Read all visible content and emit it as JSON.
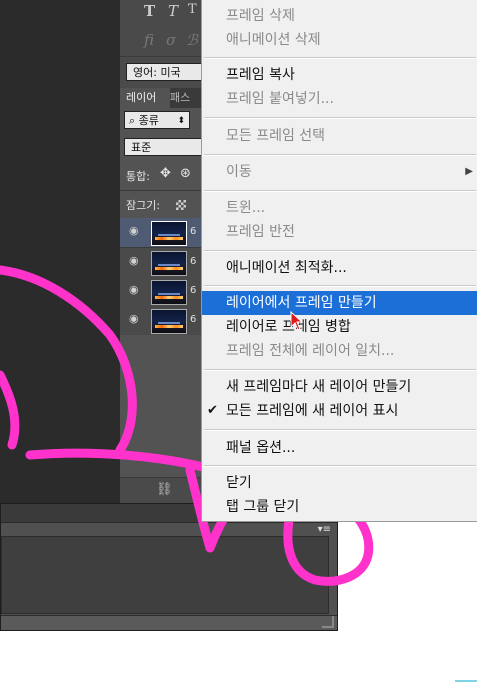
{
  "ps_panel": {
    "type_tools": [
      "T",
      "T",
      "T"
    ],
    "icon_row_2": [
      "fi",
      "σ",
      "ℬ"
    ],
    "language": "영어: 미국",
    "tabs": [
      "레이어",
      "패스"
    ],
    "kind_filter": "종류",
    "blend_mode": "표준",
    "unify_label": "통합:",
    "lock_label": "잠그기:",
    "layers": [
      {
        "num": "6"
      },
      {
        "num": "6"
      },
      {
        "num": "6"
      },
      {
        "num": "6"
      }
    ]
  },
  "context_menu": {
    "items": [
      {
        "label": "프레임 삭제",
        "enabled": false
      },
      {
        "label": "애니메이션 삭제",
        "enabled": false
      },
      {
        "label": "프레임 복사",
        "enabled": true
      },
      {
        "label": "프레임 붙여넣기...",
        "enabled": false
      },
      {
        "label": "모든 프레임 선택",
        "enabled": false
      },
      {
        "label": "이동",
        "enabled": false,
        "submenu": true
      },
      {
        "label": "트윈...",
        "enabled": false
      },
      {
        "label": "프레임 반전",
        "enabled": false
      },
      {
        "label": "애니메이션 최적화...",
        "enabled": true
      },
      {
        "label": "레이어에서 프레임 만들기",
        "enabled": true,
        "highlighted": true
      },
      {
        "label": "레이어로 프레임 병합",
        "enabled": true
      },
      {
        "label": "프레임 전체에 레이어 일치...",
        "enabled": false
      },
      {
        "label": "새 프레임마다 새 레이어 만들기",
        "enabled": true
      },
      {
        "label": "모든 프레임에 새 레이어 표시",
        "enabled": true,
        "checked": true
      },
      {
        "label": "패널 옵션...",
        "enabled": true
      },
      {
        "label": "닫기",
        "enabled": true
      },
      {
        "label": "탭 그룹 닫기",
        "enabled": true
      }
    ]
  },
  "colors": {
    "highlight": "#1c6fd6",
    "annotation": "#ff33cc"
  }
}
